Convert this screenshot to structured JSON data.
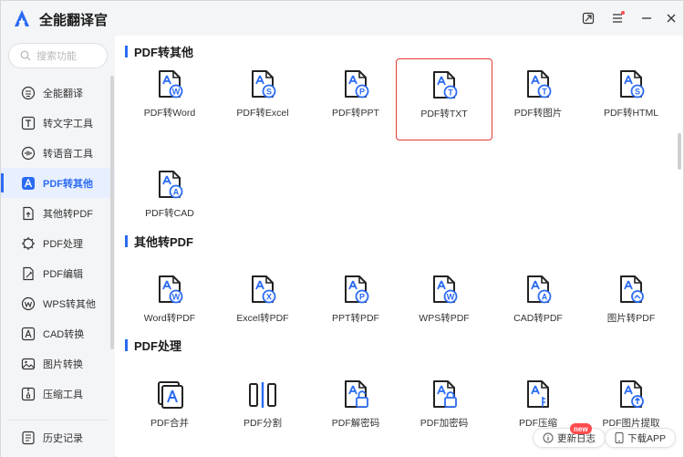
{
  "app": {
    "title": "全能翻译官"
  },
  "titlebar": {
    "icons": [
      "minimize-to-tray-icon",
      "menu-icon",
      "minimize-icon",
      "close-icon"
    ]
  },
  "sidebar": {
    "search_placeholder": "搜索功能",
    "items": [
      {
        "label": "全能翻译",
        "icon": "translate-icon"
      },
      {
        "label": "转文字工具",
        "icon": "text-icon"
      },
      {
        "label": "转语音工具",
        "icon": "audio-icon"
      },
      {
        "label": "PDF转其他",
        "icon": "pdf-icon",
        "active": true
      },
      {
        "label": "其他转PDF",
        "icon": "file-convert-icon"
      },
      {
        "label": "PDF处理",
        "icon": "pdf-process-icon"
      },
      {
        "label": "PDF编辑",
        "icon": "edit-icon"
      },
      {
        "label": "WPS转其他",
        "icon": "wps-icon"
      },
      {
        "label": "CAD转换",
        "icon": "cad-icon"
      },
      {
        "label": "图片转换",
        "icon": "image-icon"
      },
      {
        "label": "压缩工具",
        "icon": "compress-icon"
      }
    ],
    "history_label": "历史记录"
  },
  "main": {
    "sections": [
      {
        "title": "PDF转其他",
        "tiles": [
          {
            "label": "PDF转Word",
            "badge": "W"
          },
          {
            "label": "PDF转Excel",
            "badge": "S"
          },
          {
            "label": "PDF转PPT",
            "badge": "P"
          },
          {
            "label": "PDF转TXT",
            "badge": "T",
            "selected": true
          },
          {
            "label": "PDF转图片",
            "badge": "T"
          },
          {
            "label": "PDF转HTML",
            "badge": "S"
          },
          {
            "label": "PDF转CAD",
            "badge": "A"
          }
        ]
      },
      {
        "title": "其他转PDF",
        "tiles": [
          {
            "label": "Word转PDF",
            "badge": "W"
          },
          {
            "label": "Excel转PDF",
            "badge": "X"
          },
          {
            "label": "PPT转PDF",
            "badge": "P"
          },
          {
            "label": "WPS转PDF",
            "badge": "W"
          },
          {
            "label": "CAD转PDF",
            "badge": "A"
          },
          {
            "label": "图片转PDF",
            "badge": "img"
          }
        ]
      },
      {
        "title": "PDF处理",
        "tiles": [
          {
            "label": "PDF合并",
            "badge": "merge"
          },
          {
            "label": "PDF分割",
            "badge": "split"
          },
          {
            "label": "PDF解密码",
            "badge": "unlock"
          },
          {
            "label": "PDF加密码",
            "badge": "lock"
          },
          {
            "label": "PDF压缩",
            "badge": "zip"
          },
          {
            "label": "PDF图片提取",
            "badge": "extract"
          }
        ]
      }
    ],
    "update_log": {
      "label": "更新日志",
      "badge": "new"
    },
    "download_app": {
      "label": "下载APP"
    }
  },
  "colors": {
    "accent": "#2b6bf3",
    "selected_border": "#e23b36",
    "badge_red": "#ff4d4f"
  }
}
